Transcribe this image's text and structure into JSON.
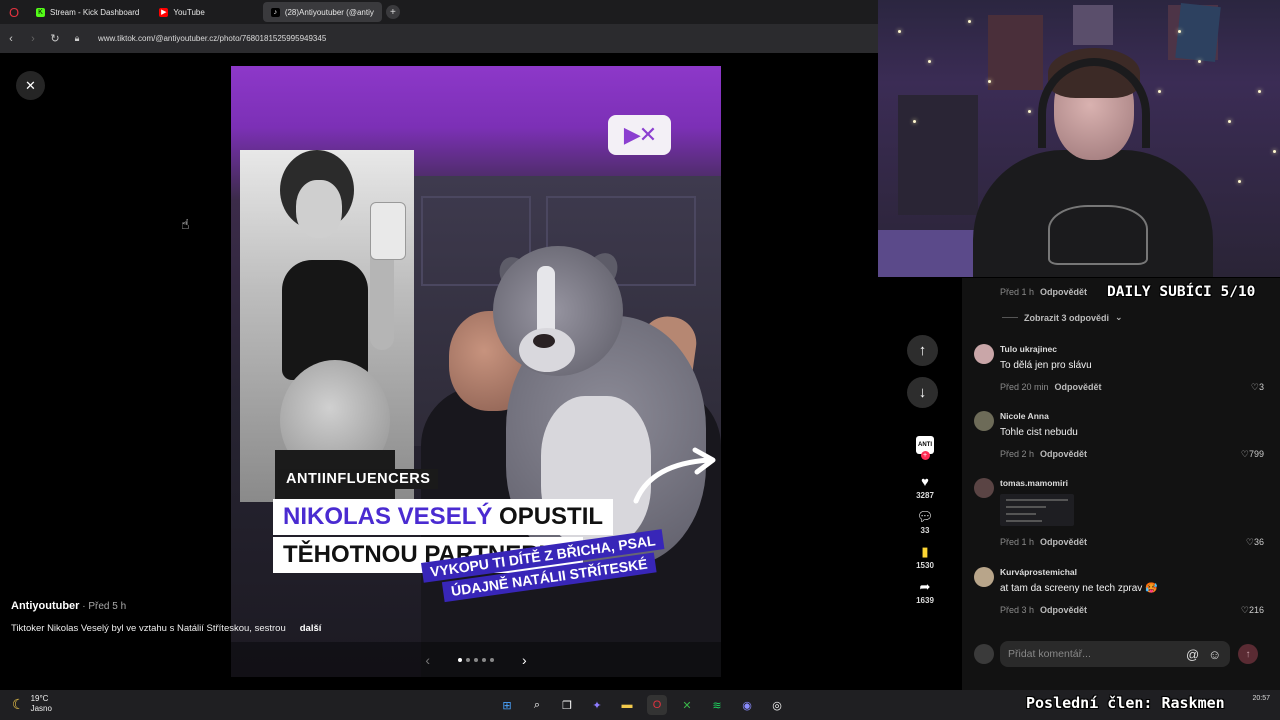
{
  "browser": {
    "tabs": [
      {
        "label": "Stream - Kick Dashboard",
        "icon": "kick-icon",
        "color": "#53fc18"
      },
      {
        "label": "YouTube",
        "icon": "youtube-icon",
        "color": "#ff0000"
      },
      {
        "label": "(28)Antiyoutuber (@antiy",
        "icon": "tiktok-icon",
        "color": "#000000"
      }
    ],
    "url": "www.tiktok.com/@antiyoutuber.cz/photo/7680181525995949345"
  },
  "post": {
    "logo_text": "▶✕",
    "tag": "ANTIINFLUENCERS",
    "headline_highlight": "NIKOLAS VESELÝ",
    "headline_rest": " OPUSTIL",
    "headline_line2": "TĚHOTNOU PARTNERKU",
    "subline1": "VYKOPU TI DÍTĚ Z BŘICHA, PSAL",
    "subline2": "ÚDAJNĚ NATÁLII STŘÍTESKÉ",
    "author": "Antiyoutuber",
    "time": " · Před 5 h",
    "description": "Tiktoker Nikolas Veselý byl ve vztahu s Natálií Stříteskou, sestrou",
    "more": "další",
    "carousel_active": 0,
    "carousel_count": 5
  },
  "actions": {
    "profile_label": "ANTI",
    "likes": "3287",
    "comments": "33",
    "bookmarks": "1530",
    "shares": "1639"
  },
  "comments": {
    "top_meta": {
      "time": "Před 1 h",
      "reply": "Odpovědět"
    },
    "view_replies": "Zobrazit 3 odpovědi",
    "items": [
      {
        "user": "Tulo ukrajinec",
        "text": "To dělá jen pro slávu",
        "time": "Před 20 min",
        "reply": "Odpovědět",
        "likes": "3"
      },
      {
        "user": "Nicole Anna",
        "text": "Tohle cist nebudu",
        "time": "Před 2 h",
        "reply": "Odpovědět",
        "likes": "799"
      },
      {
        "user": "tomas.mamomiri",
        "text": "",
        "time": "Před 1 h",
        "reply": "Odpovědět",
        "likes": "36"
      },
      {
        "user": "Kurvápr​ostemichal",
        "text": "at tam da screeny ne tech zprav 🥵",
        "time": "Před 3 h",
        "reply": "Odpovědět",
        "likes": "216"
      }
    ],
    "input_placeholder": "Přidat komentář..."
  },
  "overlay": {
    "daily_subs": "DAILY SUBÍCI 5/10",
    "last_member": "Poslední člen: Raskmen"
  },
  "taskbar": {
    "temp": "19°C",
    "condition": "Jasno",
    "time": "20:57"
  }
}
